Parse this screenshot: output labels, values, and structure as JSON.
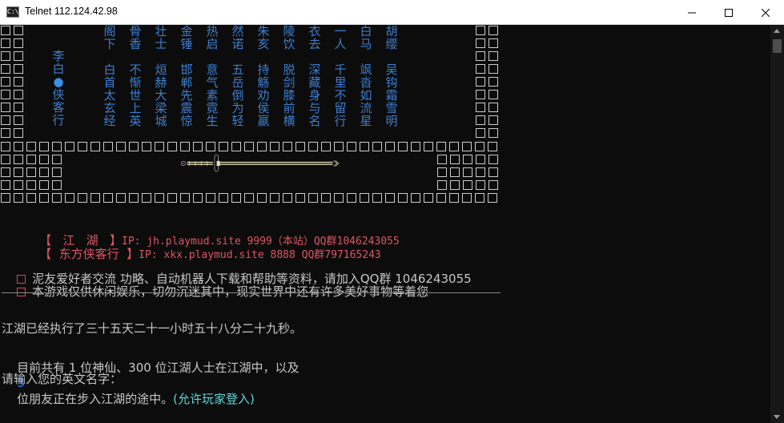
{
  "window": {
    "title": "Telnet 112.124.42.98",
    "app_icon_text": "C:\\",
    "controls": [
      "minimize",
      "maximize",
      "close"
    ]
  },
  "banner": {
    "title_column": "李白●侠客行",
    "poem_columns": [
      {
        "top": "阁下",
        "bottom": "白首太玄经"
      },
      {
        "top": "骨香",
        "bottom": "不惭世上英"
      },
      {
        "top": "壮士",
        "bottom": "烜赫大梁城"
      },
      {
        "top": "金锤",
        "bottom": "邯郸先震惊"
      },
      {
        "top": "热启",
        "bottom": "意气素霓生"
      },
      {
        "top": "然诺",
        "bottom": "五岳倒为轻"
      },
      {
        "top": "朱亥",
        "bottom": "持觞劝侯嬴"
      },
      {
        "top": "陵饮",
        "bottom": "脱剑膝前横"
      },
      {
        "top": "衣去",
        "bottom": "深藏身与名"
      },
      {
        "top": "一人",
        "bottom": "千里不留行"
      },
      {
        "top": "白马",
        "bottom": "飒沓如流星"
      },
      {
        "top": "胡缨",
        "bottom": "吴钩霜雪明"
      }
    ]
  },
  "sword": {
    "art": "⊙====【=================》"
  },
  "servers": [
    {
      "name": "【   江   湖   】",
      "info": "IP: jh.playmud.site 9999（本站）QQ群1046243055"
    },
    {
      "name": "【  东方侠客行  】",
      "info": "IP: xkx.playmud.site 8888 QQ群797165243"
    }
  ],
  "notices": [
    "泥友爱好者交流 功略、自动机器人下载和帮助等资料，请加入QQ群 1046243055",
    "本游戏仅供休闲娱乐，切勿沉迷其中，现实世界中还有许多美好事物等着您"
  ],
  "uptime": "江湖已经执行了三十五天二十一小时五十八分二十九秒。",
  "online": {
    "prefix": "目前共有 1 位神仙、300 位江湖人士在江湖中，以及",
    "count": "3",
    "middle": "位朋友正在步入江湖的途中。",
    "allow": "(允许玩家登入)"
  },
  "prompt": "请输入您的英文名字：",
  "colors": {
    "terminal_bg": "#0c0c0c",
    "poem_blue": "#3e7fd0",
    "red": "#e05561",
    "cyan": "#61d6d6",
    "gray": "#c8c8c8"
  }
}
